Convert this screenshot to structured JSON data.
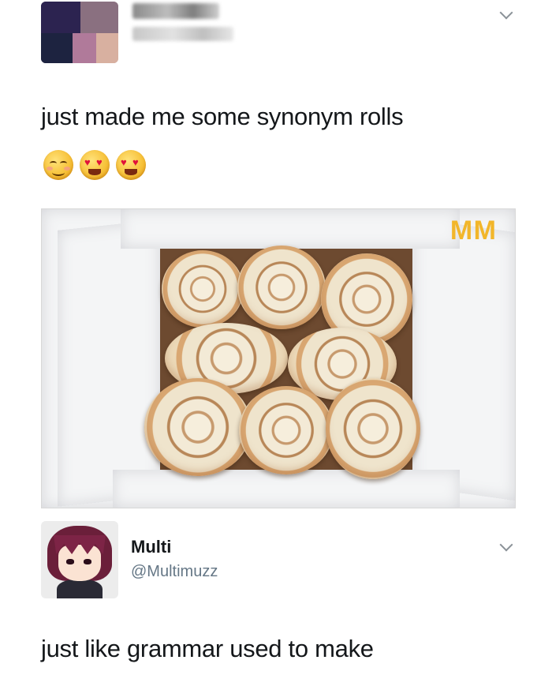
{
  "post": {
    "text": "just made me some synonym rolls",
    "emojis": [
      "smiling-face-with-smiling-eyes-icon",
      "heart-eyes-icon",
      "heart-eyes-icon"
    ],
    "image_overlay_text": "M M"
  },
  "reply": {
    "display_name": "Multi",
    "handle": "@Multimuzz",
    "text": "just like grammar used to make"
  },
  "colors": {
    "background": "#ffffff",
    "text": "#14171a",
    "secondary_text": "#657786",
    "overlay_mm": "#f2b62a"
  }
}
